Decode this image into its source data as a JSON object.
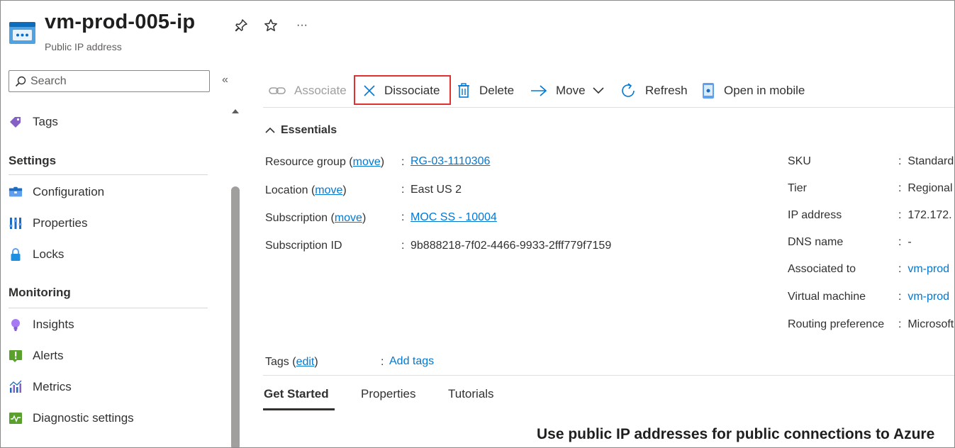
{
  "header": {
    "title": "vm-prod-005-ip",
    "subtitle": "Public IP address",
    "pin_icon": "pin-icon",
    "favorite_icon": "star-icon",
    "more_label": "···"
  },
  "sidebar": {
    "search_placeholder": "Search",
    "collapse_label": "«",
    "items_top": [
      {
        "label": "Tags",
        "icon": "tag-icon"
      }
    ],
    "sections": [
      {
        "title": "Settings",
        "items": [
          {
            "label": "Configuration",
            "icon": "configuration-icon"
          },
          {
            "label": "Properties",
            "icon": "properties-icon"
          },
          {
            "label": "Locks",
            "icon": "lock-icon"
          }
        ]
      },
      {
        "title": "Monitoring",
        "items": [
          {
            "label": "Insights",
            "icon": "lightbulb-icon"
          },
          {
            "label": "Alerts",
            "icon": "alert-icon"
          },
          {
            "label": "Metrics",
            "icon": "metrics-icon"
          },
          {
            "label": "Diagnostic settings",
            "icon": "diagnostic-icon"
          }
        ]
      }
    ]
  },
  "commands": {
    "associate": "Associate",
    "dissociate": "Dissociate",
    "delete": "Delete",
    "move": "Move",
    "refresh": "Refresh",
    "open_mobile": "Open in mobile"
  },
  "essentials": {
    "heading": "Essentials",
    "move_link": "move",
    "left": {
      "resource_group_label": "Resource group",
      "resource_group_value": "RG-03-1110306",
      "location_label": "Location",
      "location_value": "East US 2",
      "subscription_label": "Subscription",
      "subscription_value": "MOC SS - 10004",
      "subscription_id_label": "Subscription ID",
      "subscription_id_value": "9b888218-7f02-4466-9933-2fff779f7159"
    },
    "right": [
      {
        "label": "SKU",
        "value": "Standard",
        "link": false
      },
      {
        "label": "Tier",
        "value": "Regional",
        "link": false
      },
      {
        "label": "IP address",
        "value": "172.172.",
        "link": false
      },
      {
        "label": "DNS name",
        "value": "-",
        "link": false
      },
      {
        "label": "Associated to",
        "value": "vm-prod",
        "link": true
      },
      {
        "label": "Virtual machine",
        "value": "vm-prod",
        "link": true
      },
      {
        "label": "Routing preference",
        "value": "Microsoft",
        "link": false
      }
    ],
    "tags_label": "Tags",
    "tags_edit": "edit",
    "tags_value": "Add tags"
  },
  "tabs": [
    "Get Started",
    "Properties",
    "Tutorials"
  ],
  "promo_heading": "Use public IP addresses for public connections to Azure",
  "colors": {
    "accent": "#0078d4",
    "highlight": "#e0312f"
  }
}
